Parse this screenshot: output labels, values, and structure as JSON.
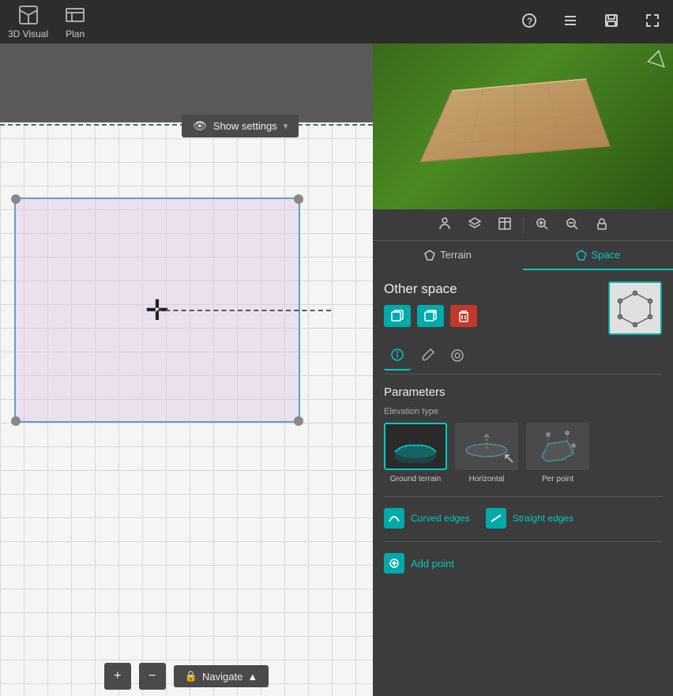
{
  "topBar": {
    "items": [
      {
        "id": "3d-visual",
        "label": "3D Visual",
        "icon": "cube"
      },
      {
        "id": "plan",
        "label": "Plan",
        "icon": "plan"
      }
    ],
    "headerIcons": [
      "help",
      "list",
      "save",
      "fullscreen"
    ]
  },
  "canvas": {
    "showSettingsBtn": "Show settings",
    "bottomBar": {
      "zoomIn": "+",
      "zoomOut": "−",
      "navigate": "Navigate",
      "navigateChevron": "▲"
    }
  },
  "rightPanel": {
    "iconBar": [
      "person",
      "layers",
      "table",
      "zoom-in",
      "zoom-out",
      "lock"
    ],
    "tabs": [
      {
        "id": "terrain",
        "label": "Terrain",
        "active": false
      },
      {
        "id": "space",
        "label": "Space",
        "active": true
      }
    ],
    "panelTitle": "Other space",
    "actionButtons": [
      "copy-flat",
      "copy-up",
      "delete"
    ],
    "subTabs": [
      "info",
      "edit",
      "paint"
    ],
    "parametersTitle": "Parameters",
    "elevationTypeLabel": "Elevation type",
    "elevationOptions": [
      {
        "id": "ground-terrain",
        "label": "Ground terrain",
        "selected": true
      },
      {
        "id": "horizontal",
        "label": "Horizontal",
        "selected": false
      },
      {
        "id": "per-point",
        "label": "Per point",
        "selected": false
      }
    ],
    "edgeButtons": [
      {
        "id": "curved-edges",
        "label": "Curved edges"
      },
      {
        "id": "straight-edges",
        "label": "Straight edges"
      }
    ],
    "addPointLabel": "Add point"
  }
}
